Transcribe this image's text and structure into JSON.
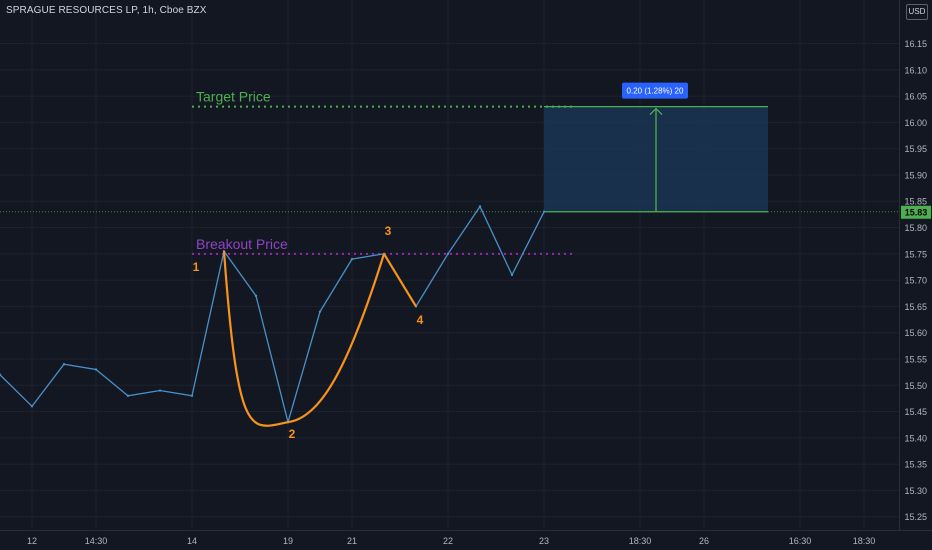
{
  "header": {
    "title": "SPRAGUE RESOURCES LP, 1h, Cboe BZX",
    "currency": "USD"
  },
  "colors": {
    "background": "#131722",
    "grid": "#1e222d",
    "price_line": "#4a90c8",
    "cup_handle": "#f7931a",
    "target": "#4caf50",
    "breakout": "#9c27b0",
    "box_fill": "#1b3554",
    "badge": "#2962ff"
  },
  "chart_data": {
    "type": "line",
    "ylim": [
      15.2,
      16.2
    ],
    "y_ticks": [
      16.15,
      16.1,
      16.05,
      16.0,
      15.95,
      15.9,
      15.85,
      15.8,
      15.75,
      15.7,
      15.65,
      15.6,
      15.55,
      15.5,
      15.45,
      15.4,
      15.35,
      15.3,
      15.25
    ],
    "x_ticks": [
      "12",
      "14:30",
      "14",
      "19",
      "21",
      "22",
      "23",
      "18:30",
      "26",
      "16:30",
      "18:30"
    ],
    "series": [
      {
        "values": [
          15.52,
          15.46,
          15.54,
          15.53,
          15.48,
          15.49,
          15.48,
          15.755,
          15.67,
          15.43,
          15.64,
          15.74,
          15.75,
          15.65,
          15.75,
          15.84,
          15.71,
          15.83
        ]
      }
    ],
    "last_price": 15.83,
    "last_price_label": "15.83",
    "target_price": 16.03,
    "target_label": "Target Price",
    "breakout_price": 15.75,
    "breakout_label": "Breakout Price",
    "measure_label": "0.20 (1.28%) 20",
    "points": [
      "1",
      "2",
      "3",
      "4"
    ]
  }
}
